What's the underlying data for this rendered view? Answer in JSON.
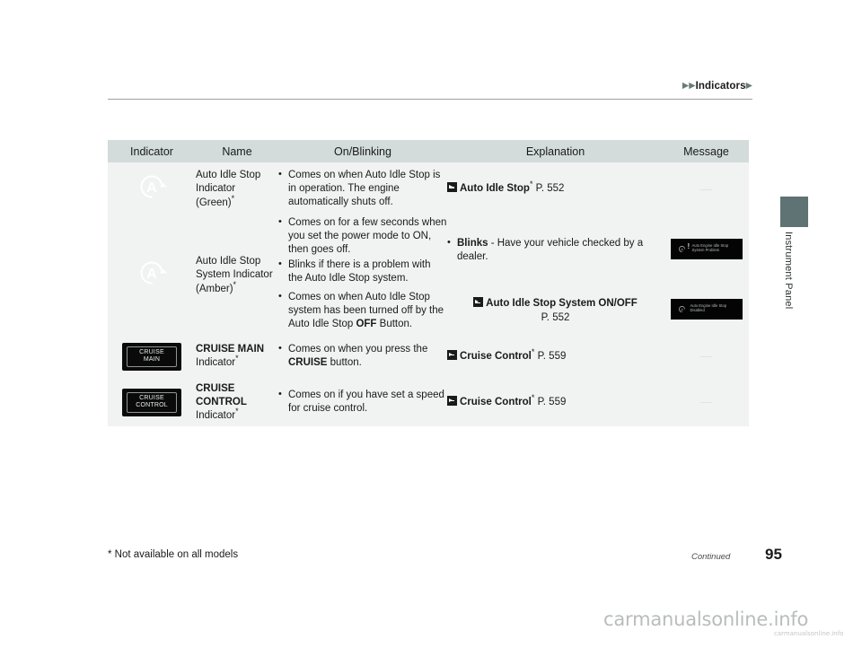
{
  "header": {
    "breadcrumb_prefix": "▶▶",
    "breadcrumb_label": "Indicators",
    "breadcrumb_suffix": "▶"
  },
  "side_tab": {
    "label": "Instrument Panel"
  },
  "table": {
    "columns": [
      "Indicator",
      "Name",
      "On/Blinking",
      "Explanation",
      "Message"
    ],
    "rows": [
      {
        "indicator_icon": "auto-idle-stop-indicator-icon",
        "name": "Auto Idle Stop Indicator (Green)",
        "name_line1": "Auto Idle Stop",
        "name_line2": "Indicator",
        "name_line3": "(Green)",
        "name_star": "*",
        "name_bold": false,
        "onblinking": [
          "Comes on when Auto Idle Stop is in operation. The engine automatically shuts off."
        ],
        "explanation": {
          "icon": "reference-arrow-icon",
          "title": "Auto Idle Stop",
          "star": "*",
          "page": "P. 552"
        },
        "message": "—"
      },
      {
        "indicator_icon": "auto-idle-stop-system-indicator-icon",
        "name": "Auto Idle Stop System Indicator (Amber)",
        "name_line1": "Auto Idle Stop",
        "name_line2": "System Indicator",
        "name_line3": "(Amber)",
        "name_star": "*",
        "name_bold": false,
        "sub_rows": [
          {
            "onblinking": [
              "Comes on for a few seconds when you set the power mode to ON, then goes off.",
              "Blinks if there is a problem with the Auto Idle Stop system."
            ],
            "explanation_bullet": {
              "bold": "Blinks",
              "rest": " - Have your vehicle checked by a dealer."
            },
            "message_screen": {
              "icon": "auto-idle-stop-warning-icon",
              "bang": "!",
              "text_line1": "Auto Engine Idle Stop",
              "text_line2": "System Problem"
            }
          },
          {
            "onblinking_rich": {
              "pre": "Comes on when Auto Idle Stop system has been turned off by the Auto Idle Stop ",
              "bold": "OFF",
              "post": " Button."
            },
            "explanation": {
              "icon": "reference-arrow-icon",
              "title": "Auto Idle Stop System ON/OFF",
              "page": "P. 552"
            },
            "message_screen": {
              "icon": "auto-idle-stop-icon",
              "bang": "",
              "text_line1": "Auto Engine Idle Stop",
              "text_line2": "Disabled"
            }
          }
        ]
      },
      {
        "indicator_icon": "cruise-main-indicator-icon",
        "indicator_text_line1": "CRUISE",
        "indicator_text_line2": "MAIN",
        "name_bold_text": "CRUISE MAIN",
        "name_sub": "Indicator",
        "name_star": "*",
        "onblinking_rich": {
          "pre": "Comes on when you press the ",
          "bold": "CRUISE",
          "post": " button."
        },
        "explanation": {
          "icon": "reference-arrow-icon",
          "title": "Cruise Control",
          "star": "*",
          "page": "P. 559"
        },
        "message": "—"
      },
      {
        "indicator_icon": "cruise-control-indicator-icon",
        "indicator_text_line1": "CRUISE",
        "indicator_text_line2": "CONTROL",
        "name_bold_line1": "CRUISE",
        "name_bold_line2": "CONTROL",
        "name_sub": "Indicator",
        "name_star": "*",
        "onblinking": [
          "Comes on if you have set a speed for cruise control."
        ],
        "explanation": {
          "icon": "reference-arrow-icon",
          "title": "Cruise Control",
          "star": "*",
          "page": "P. 559"
        },
        "message": "—"
      }
    ]
  },
  "footer": {
    "note": "* Not available on all models",
    "continued": "Continued",
    "page_number": "95"
  },
  "watermark": {
    "main": "carmanualsonline.info",
    "sub": "carmanualsonline.info"
  },
  "colors": {
    "header_bg": "#d3dbdb",
    "cell_bg": "#f1f2f2",
    "dark_cell": "#4e5f61",
    "screen_black": "#040404",
    "text": "#1a1a1a"
  }
}
